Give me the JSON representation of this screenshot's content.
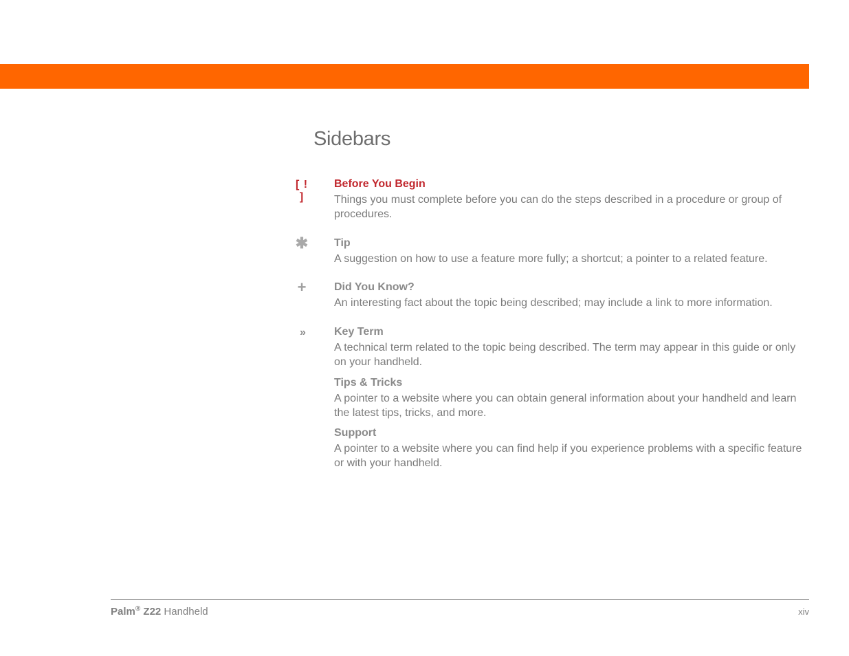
{
  "colors": {
    "accent_orange": "#ff6600",
    "accent_red": "#c1272d",
    "text_gray": "#7b7b7b",
    "title_gray": "#8a8a8a",
    "rule_gray": "#808080"
  },
  "page": {
    "title": "Sidebars"
  },
  "entries": [
    {
      "icon": "[ ! ]",
      "icon_name": "exclamation-bracket-icon",
      "title": "Before You Begin",
      "title_color": "red",
      "body": "Things you must complete before you can do the steps described in a procedure or group of procedures."
    },
    {
      "icon": "✱",
      "icon_name": "asterisk-icon",
      "title": "Tip",
      "title_color": "gray",
      "body": "A suggestion on how to use a feature more fully; a shortcut; a pointer to a related feature."
    },
    {
      "icon": "+",
      "icon_name": "plus-icon",
      "title": "Did You Know?",
      "title_color": "gray",
      "body": "An interesting fact about the topic being described; may include a link to more information."
    },
    {
      "icon": "»",
      "icon_name": "chevrons-icon",
      "title": "Key Term",
      "title_color": "gray",
      "body": "A technical term related to the topic being described. The term may appear in this guide or only on your handheld."
    },
    {
      "icon": "",
      "icon_name": "",
      "title": "Tips & Tricks",
      "title_color": "gray",
      "body": "A pointer to a website where you can obtain general information about your handheld and learn the latest tips, tricks, and more."
    },
    {
      "icon": "",
      "icon_name": "",
      "title": "Support",
      "title_color": "gray",
      "body": "A pointer to a website where you can find help if you experience problems with a specific feature or with your handheld."
    }
  ],
  "footer": {
    "product_brand": "Palm",
    "product_reg": "®",
    "product_model": " Z22",
    "product_suffix": " Handheld",
    "page_number": "xiv"
  }
}
